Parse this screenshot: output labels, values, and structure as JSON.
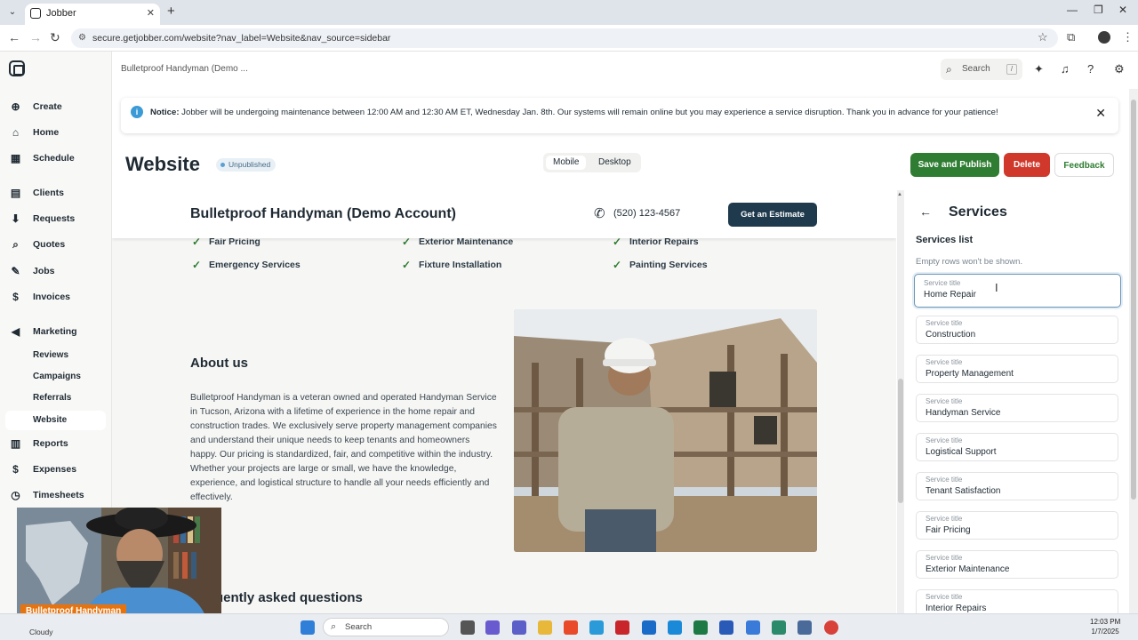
{
  "browser": {
    "tab_title": "Jobber",
    "url": "secure.getjobber.com/website?nav_label=Website&nav_source=sidebar"
  },
  "sidebar": {
    "items": [
      {
        "label": "Create",
        "icon": "plus-circle-icon"
      },
      {
        "label": "Home",
        "icon": "home-icon"
      },
      {
        "label": "Schedule",
        "icon": "calendar-icon"
      },
      {
        "label": "Clients",
        "icon": "clients-icon"
      },
      {
        "label": "Requests",
        "icon": "requests-icon"
      },
      {
        "label": "Quotes",
        "icon": "quotes-icon"
      },
      {
        "label": "Jobs",
        "icon": "wrench-icon"
      },
      {
        "label": "Invoices",
        "icon": "invoice-icon"
      },
      {
        "label": "Marketing",
        "icon": "megaphone-icon"
      },
      {
        "label": "Reports",
        "icon": "reports-icon"
      },
      {
        "label": "Expenses",
        "icon": "expenses-icon"
      },
      {
        "label": "Timesheets",
        "icon": "clock-icon"
      }
    ],
    "marketing_sub": [
      "Reviews",
      "Campaigns",
      "Referrals",
      "Website"
    ],
    "active": "Website"
  },
  "header": {
    "account": "Bulletproof Handyman (Demo ...",
    "search_placeholder": "Search",
    "search_shortcut": "/"
  },
  "notice": {
    "bold": "Notice:",
    "text": " Jobber will be undergoing maintenance between 12:00 AM and 12:30 AM ET, Wednesday Jan. 8th. Our systems will remain online but you may experience a service disruption. Thank you in advance for your patience!"
  },
  "page": {
    "title": "Website",
    "status": "Unpublished",
    "view_mobile": "Mobile",
    "view_desktop": "Desktop",
    "save_publish": "Save and Publish",
    "delete": "Delete",
    "feedback": "Feedback"
  },
  "preview": {
    "business_name": "Bulletproof Handyman (Demo Account)",
    "phone": "(520) 123-4567",
    "cta": "Get an Estimate",
    "services": [
      "Fair Pricing",
      "Exterior Maintenance",
      "Interior Repairs",
      "Emergency Services",
      "Fixture Installation",
      "Painting Services"
    ],
    "about_heading": "About us",
    "about_text": "Bulletproof Handyman is a veteran owned and operated Handyman Service in Tucson, Arizona with a lifetime of experience in the home repair and construction trades. We exclusively serve property management companies and understand their unique needs to keep tenants and homeowners happy. Our pricing is standardized, fair, and competitive within the industry. Whether your projects are large or small, we have the knowledge, experience, and logistical structure to handle all your needs efficiently and effectively.",
    "faq_heading": "uently asked questions"
  },
  "panel": {
    "title": "Services",
    "list_heading": "Services list",
    "hint": "Empty rows won't be shown.",
    "field_label": "Service title",
    "fields": [
      "Home Repair",
      "Construction",
      "Property Management",
      "Handyman Service",
      "Logistical Support",
      "Tenant Satisfaction",
      "Fair Pricing",
      "Exterior Maintenance",
      "Interior Repairs"
    ]
  },
  "overlay": {
    "cam_label": "Bulletproof Handyman"
  },
  "taskbar": {
    "weather": "Cloudy",
    "search": "Search",
    "time": "12:03 PM",
    "date": "1/7/2025"
  },
  "colors": {
    "primary_green": "#2f7d32",
    "delete_red": "#d0382b",
    "cta_navy": "#1f3a4d",
    "text_dark": "#1f2a33"
  }
}
